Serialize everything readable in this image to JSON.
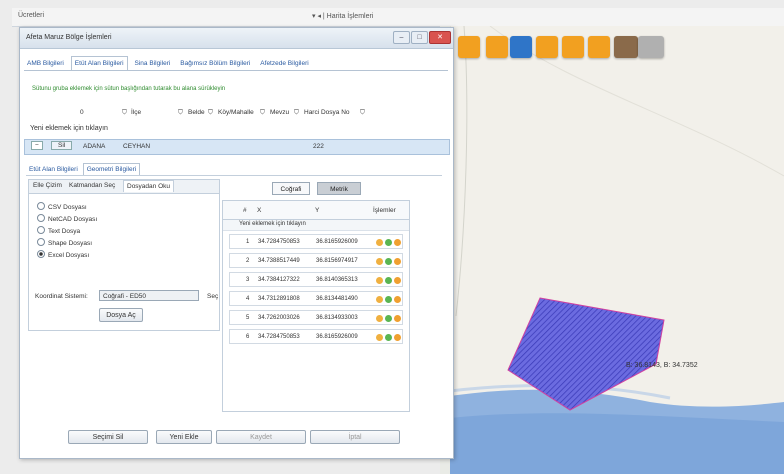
{
  "topbar": {
    "left": "Ücretleri",
    "right": "▾ ◂ | Harita İşlemleri"
  },
  "dialog": {
    "title": "Afeta Maruz Bölge İşlemleri"
  },
  "tabs": [
    "AMB Bilgileri",
    "Etüt Alan Bilgileri",
    "Sina Bilgileri",
    "Bağımsız Bölüm Bilgileri",
    "Afetzede Bilgileri"
  ],
  "note": "Sütunu gruba eklemek için sütun başlığından tutarak bu alana sürükleyin",
  "filters": {
    "c0": "0",
    "c1": "İlçe",
    "c2": "Belde",
    "c3": "Köy/Mahalle",
    "c4": "Mevzu",
    "c5": "Harci Dosya No"
  },
  "new_record": "Yeni eklemek için tıklayın",
  "row": {
    "btn_minus": "−",
    "btn_sil": "Sil",
    "il": "ADANA",
    "ilce": "CEYHAN",
    "val": "222"
  },
  "subtabs": [
    "Etüt Alan Bilgileri",
    "Geometri Bilgileri"
  ],
  "left_tabs": [
    "Elle Çizim",
    "Katmandan Seç",
    "Dosyadan Oku"
  ],
  "radios": [
    {
      "label": "CSV Dosyası",
      "on": false
    },
    {
      "label": "NetCAD Dosyası",
      "on": false
    },
    {
      "label": "Text Dosya",
      "on": false
    },
    {
      "label": "Shape Dosyası",
      "on": false
    },
    {
      "label": "Excel Dosyası",
      "on": true
    }
  ],
  "coord": {
    "label": "Koordinat Sistemi:",
    "value": "Coğrafi - ED50",
    "sec": "Seç"
  },
  "file_btn": "Dosya Aç",
  "right": {
    "btn_geo": "Coğrafi",
    "btn_metric": "Metrik",
    "headers": {
      "n": "#",
      "x": "X",
      "y": "Y",
      "ops": "İşlemler"
    },
    "new_record": "Yeni eklemek için tıklayın",
    "rows": [
      {
        "n": "1",
        "x": "34.7284750853",
        "y": "36.8165926009"
      },
      {
        "n": "2",
        "x": "34.7388517449",
        "y": "36.8156974917"
      },
      {
        "n": "3",
        "x": "34.7384127322",
        "y": "36.8140365313"
      },
      {
        "n": "4",
        "x": "34.7312891808",
        "y": "36.8134481490"
      },
      {
        "n": "5",
        "x": "34.7262003026",
        "y": "36.8134933003"
      },
      {
        "n": "6",
        "x": "34.7284750853",
        "y": "36.8165926009"
      }
    ]
  },
  "bottom": {
    "b1": "Seçimi Sil",
    "b2": "Yeni Ekle",
    "b3": "Kaydet",
    "b4": "İptal"
  },
  "map": {
    "coord_label": "B: 36.8143, B: 34.7352",
    "polygon_color": "#5a5ad8"
  }
}
